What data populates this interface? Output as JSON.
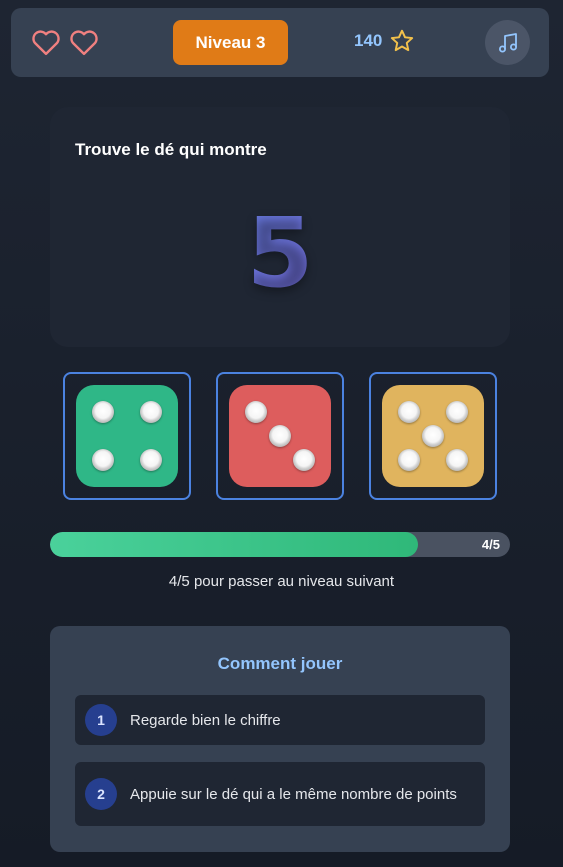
{
  "header": {
    "lives": [
      "heart-outline",
      "heart-outline"
    ],
    "level_label": "Niveau 3",
    "score": "140",
    "score_icon": "star-outline",
    "music_icon": "music-note"
  },
  "target": {
    "prompt": "Trouve le dé qui montre",
    "number": "5"
  },
  "choices": [
    {
      "pips": 4,
      "color": "#2fb787"
    },
    {
      "pips": 3,
      "color": "#dd5d5d"
    },
    {
      "pips": 5,
      "color": "#e0b45e"
    }
  ],
  "progress": {
    "current": 4,
    "total": 5,
    "fraction": 0.8,
    "label": "4/5",
    "text": "4/5 pour passer au niveau suivant"
  },
  "how_to": {
    "title": "Comment jouer",
    "steps": [
      {
        "number": "1",
        "text": "Regarde bien le chiffre"
      },
      {
        "number": "2",
        "text": "Appuie sur le dé qui a le même nombre de points"
      }
    ]
  },
  "colors": {
    "accent": "#e07b17",
    "choice_border": "#4b82e0",
    "progress": "#3cc48a",
    "heart": "#f08080",
    "star": "#f3c14b"
  }
}
